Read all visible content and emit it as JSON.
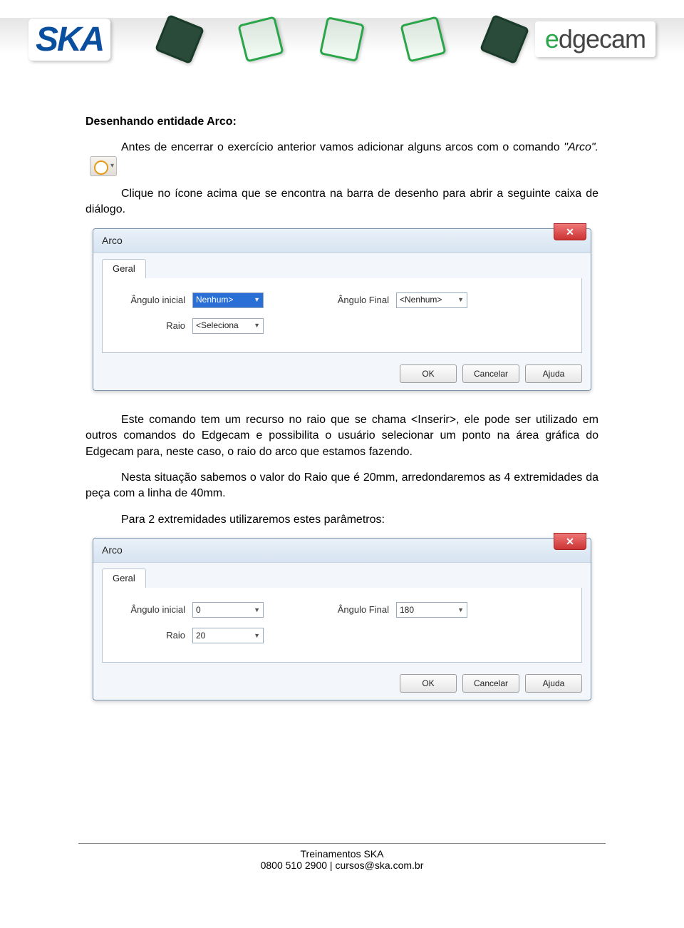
{
  "header": {
    "logo_left": "SKA",
    "logo_right_e": "e",
    "logo_right_rest": "dgecam"
  },
  "content": {
    "title": "Desenhando entidade Arco:",
    "p1_a": "Antes de encerrar o exercício anterior vamos adicionar alguns arcos com o comando ",
    "p1_b": "\"Arco\".",
    "p2": "Clique no ícone acima que se encontra na barra de desenho para abrir a seguinte caixa de diálogo.",
    "p3": "Este comando tem um recurso no raio que se chama <Inserir>, ele pode ser utilizado em outros comandos do Edgecam e possibilita o usuário selecionar um ponto na área gráfica do Edgecam para, neste caso, o raio do arco que estamos fazendo.",
    "p4": "Nesta situação sabemos o valor do Raio que é 20mm, arredondaremos as 4 extremidades da peça com a linha de 40mm.",
    "p5": "Para 2 extremidades utilizaremos estes parâmetros:"
  },
  "dialog1": {
    "title": "Arco",
    "tab": "Geral",
    "angulo_inicial_label": "Ângulo inicial",
    "angulo_inicial_value": "Nenhum>",
    "angulo_final_label": "Ângulo Final",
    "angulo_final_value": "<Nenhum>",
    "raio_label": "Raio",
    "raio_value": "<Seleciona",
    "ok": "OK",
    "cancelar": "Cancelar",
    "ajuda": "Ajuda"
  },
  "dialog2": {
    "title": "Arco",
    "tab": "Geral",
    "angulo_inicial_label": "Ângulo inicial",
    "angulo_inicial_value": "0",
    "angulo_final_label": "Ângulo Final",
    "angulo_final_value": "180",
    "raio_label": "Raio",
    "raio_value": "20",
    "ok": "OK",
    "cancelar": "Cancelar",
    "ajuda": "Ajuda"
  },
  "footer": {
    "line1": "Treinamentos SKA",
    "line2": "0800 510 2900 | cursos@ska.com.br"
  }
}
